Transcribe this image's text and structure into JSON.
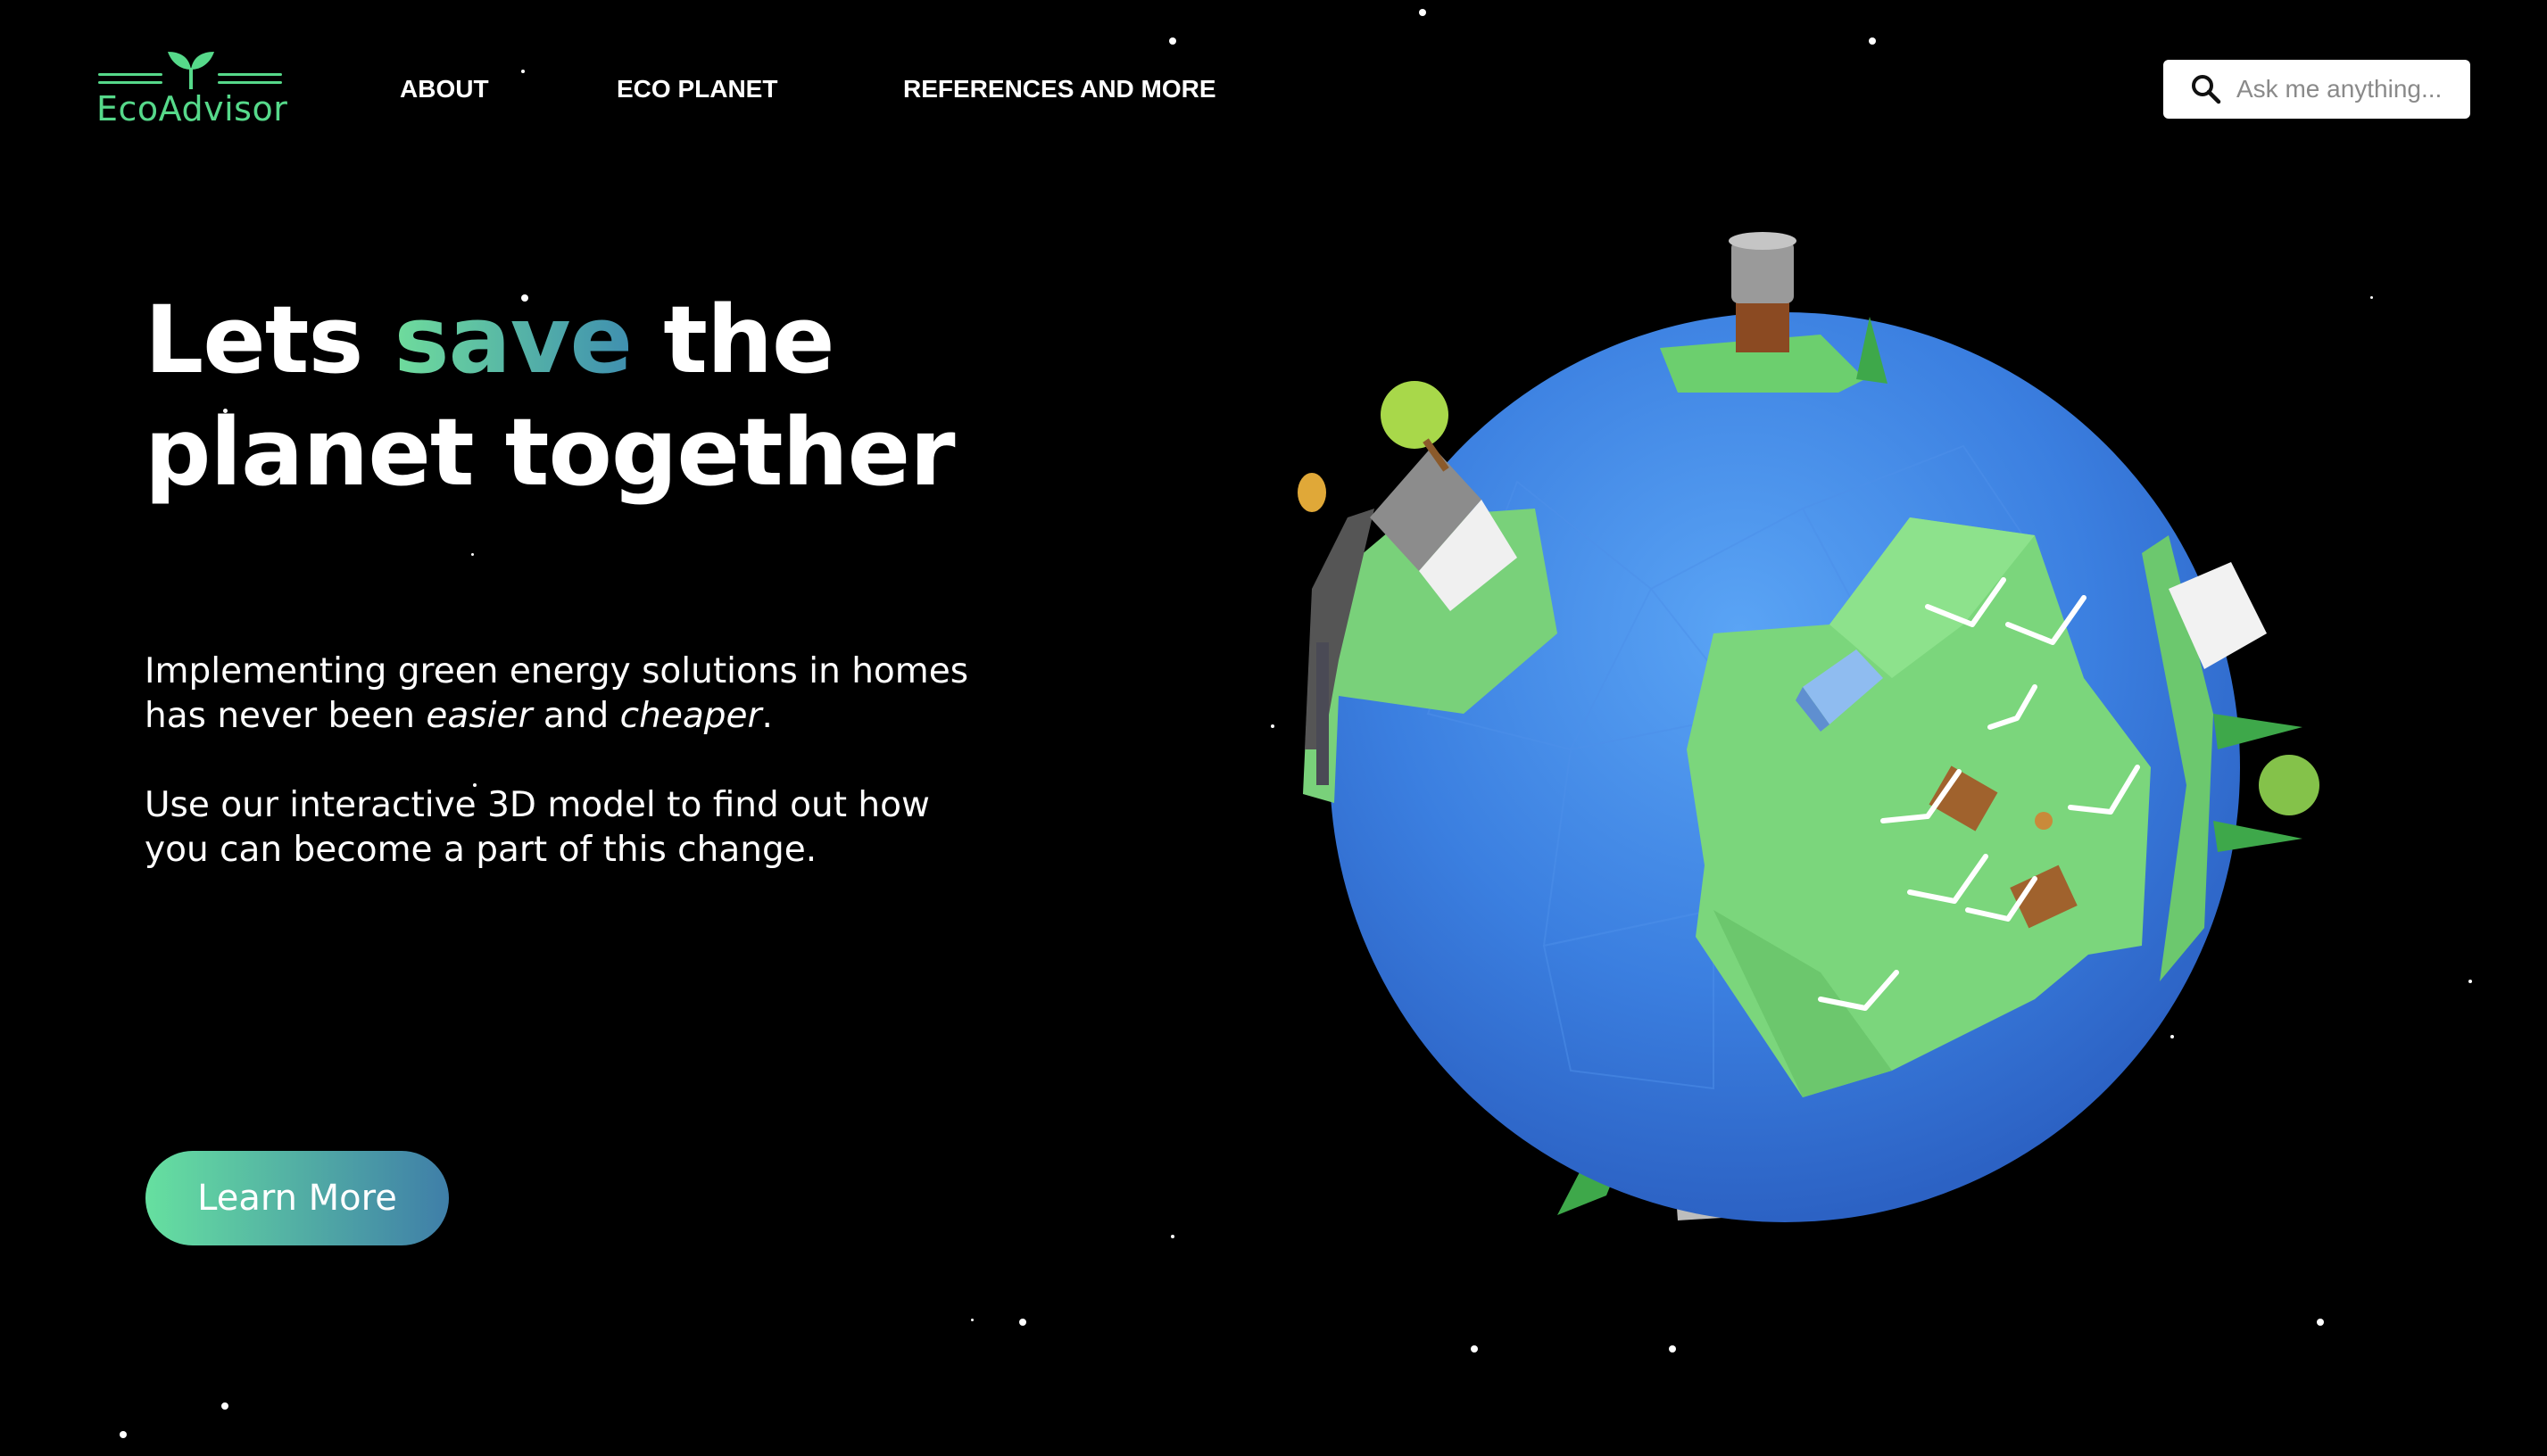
{
  "brand": {
    "name": "EcoAdvisor",
    "color": "#56d98a",
    "icon": "sprout-icon"
  },
  "nav": {
    "items": [
      {
        "label": "ABOUT"
      },
      {
        "label": "ECO PLANET"
      },
      {
        "label": "REFERENCES AND MORE"
      }
    ]
  },
  "search": {
    "placeholder": "Ask me anything...",
    "value": "",
    "icon": "search-icon"
  },
  "hero": {
    "title_part1": "Lets ",
    "title_highlight": "save",
    "title_part2": " the",
    "title_line2": "planet together",
    "p1_line1": "Implementing green energy solutions in homes",
    "p1_line2_a": "has never been ",
    "p1_line2_em1": "easier",
    "p1_line2_b": " and ",
    "p1_line2_em2": "cheaper",
    "p1_line2_c": ".",
    "p2_line1": "Use our interactive 3D model to find out how",
    "p2_line2": "you can become a part of this change.",
    "cta_label": "Learn More"
  },
  "colors": {
    "accent_green": "#6fdc9c",
    "accent_blue": "#3f8fb0",
    "planet_ocean": "#3b7fe0",
    "planet_land": "#79d67a"
  }
}
